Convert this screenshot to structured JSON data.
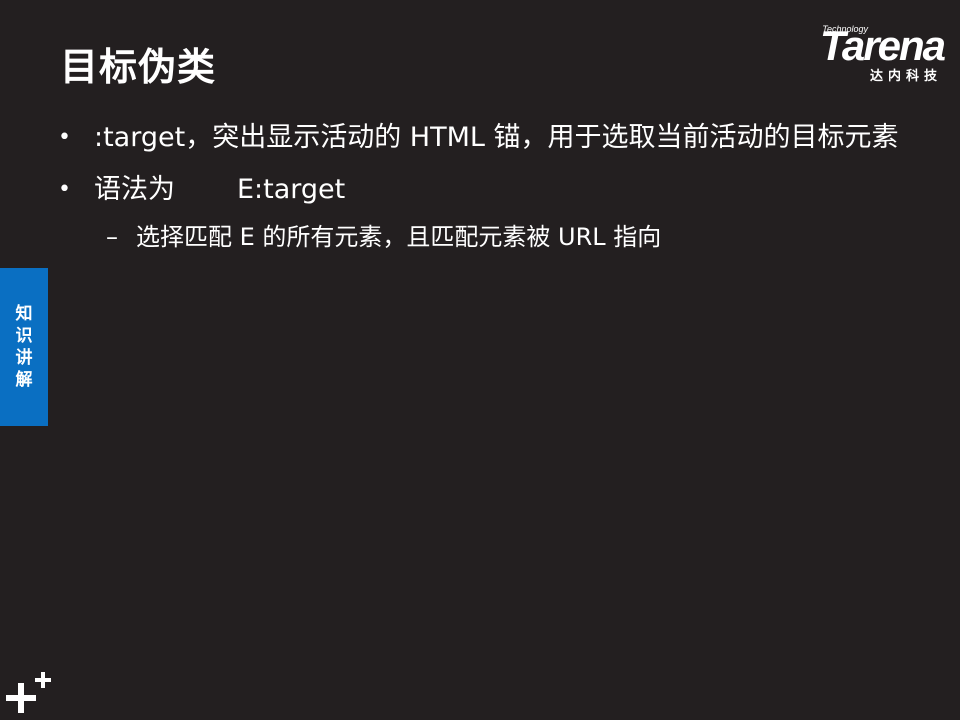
{
  "header": {
    "title": "目标伪类"
  },
  "logo": {
    "tagline": "Technology",
    "wordmark": "Tarena",
    "chinese": "达内科技"
  },
  "content": {
    "bullets": [
      {
        "text": ":target，突出显示活动的 HTML 锚，用于选取当前活动的目标元素"
      },
      {
        "label": "语法为",
        "code": "E:target",
        "sub": "选择匹配 E 的所有元素，且匹配元素被 URL 指向"
      }
    ],
    "bullet_symbol": "•",
    "dash_symbol": "–"
  },
  "sidebar": {
    "tab_label": "知识讲解"
  },
  "colors": {
    "background": "#231f20",
    "accent": "#0a6fc2",
    "text": "#ffffff"
  },
  "icons": {
    "corner": "plus-mark-icon"
  }
}
